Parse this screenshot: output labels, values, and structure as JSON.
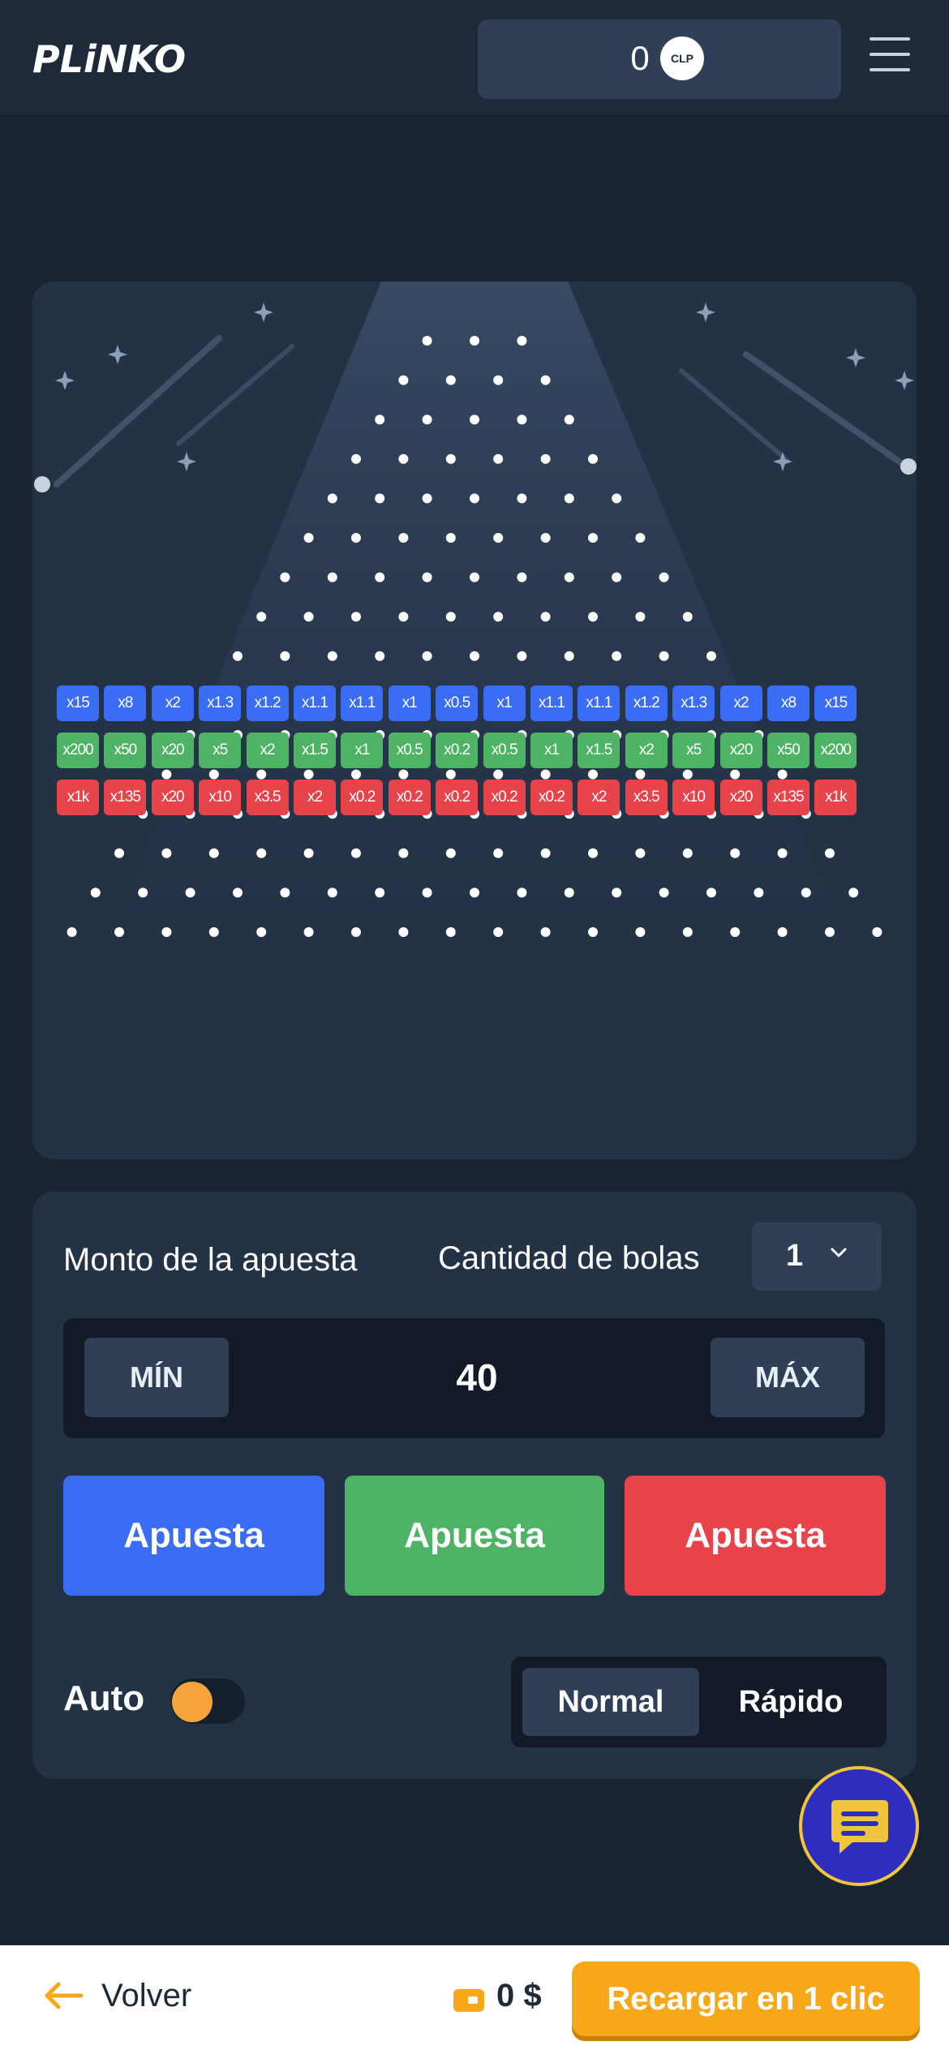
{
  "header": {
    "logo": "PLiNKO",
    "balance": "0",
    "currency": "CLP"
  },
  "board": {
    "peg_rows": 16,
    "rows": [
      {
        "color": "#3b6cf5",
        "values": [
          "x15",
          "x8",
          "x2",
          "x1.3",
          "x1.2",
          "x1.1",
          "x1.1",
          "x1",
          "x0.5",
          "x1",
          "x1.1",
          "x1.1",
          "x1.2",
          "x1.3",
          "x2",
          "x8",
          "x15"
        ]
      },
      {
        "color": "#4eb365",
        "values": [
          "x200",
          "x50",
          "x20",
          "x5",
          "x2",
          "x1.5",
          "x1",
          "x0.5",
          "x0.2",
          "x0.5",
          "x1",
          "x1.5",
          "x2",
          "x5",
          "x20",
          "x50",
          "x200"
        ]
      },
      {
        "color": "#e8434b",
        "values": [
          "x1k",
          "x135",
          "x20",
          "x10",
          "x3.5",
          "x2",
          "x0.2",
          "x0.2",
          "x0.2",
          "x0.2",
          "x0.2",
          "x2",
          "x3.5",
          "x10",
          "x20",
          "x135",
          "x1k"
        ]
      }
    ]
  },
  "controls": {
    "amount_label": "Monto de la apuesta",
    "balls_label": "Cantidad de bolas",
    "balls_value": "1",
    "min_label": "MÍN",
    "max_label": "MÁX",
    "amount_value": "40",
    "bet_label": "Apuesta",
    "auto_label": "Auto",
    "speed_normal": "Normal",
    "speed_fast": "Rápido"
  },
  "bottom": {
    "back_label": "Volver",
    "wallet_amount": "0 $",
    "recharge_label": "Recargar en 1 clic"
  },
  "colors": {
    "accent_blue": "#3b6cf5",
    "accent_green": "#4eb365",
    "accent_red": "#e8434b",
    "recharge_orange": "#f8a718"
  }
}
